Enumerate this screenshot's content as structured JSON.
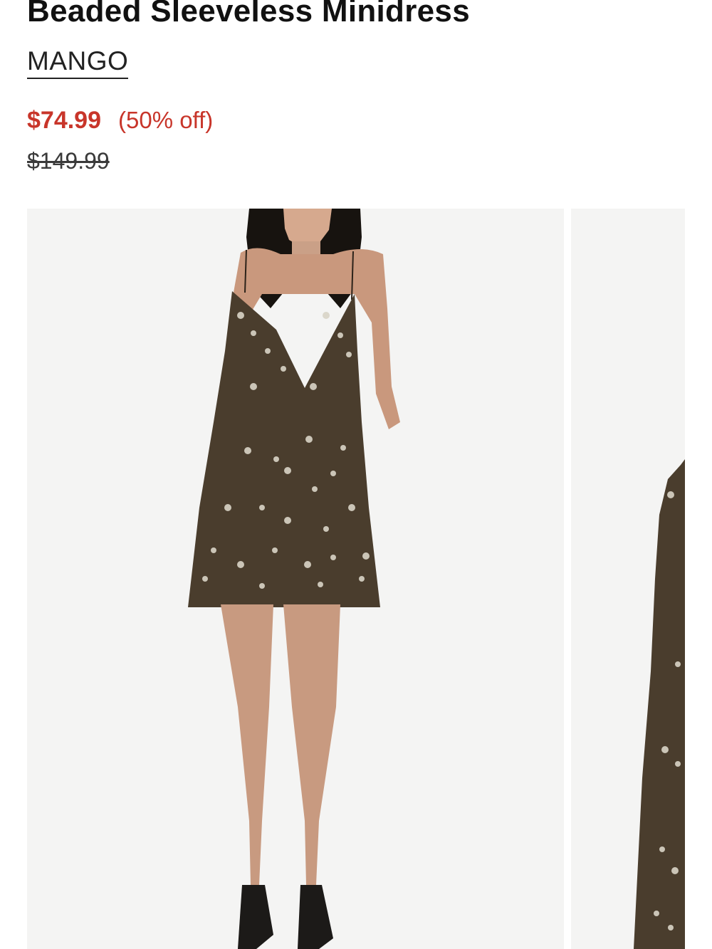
{
  "product": {
    "title": "Beaded Sleeveless Minidress",
    "brand": "MANGO",
    "sale_price": "$74.99",
    "discount": "(50% off)",
    "original_price": "$149.99"
  },
  "colors": {
    "sale": "#c8352a",
    "text": "#111111",
    "photo_bg": "#f4f4f3",
    "dress": "#4a3d2d"
  },
  "gallery": {
    "images": [
      {
        "alt": "model-front-photo"
      },
      {
        "alt": "dress-detail-photo"
      }
    ]
  }
}
